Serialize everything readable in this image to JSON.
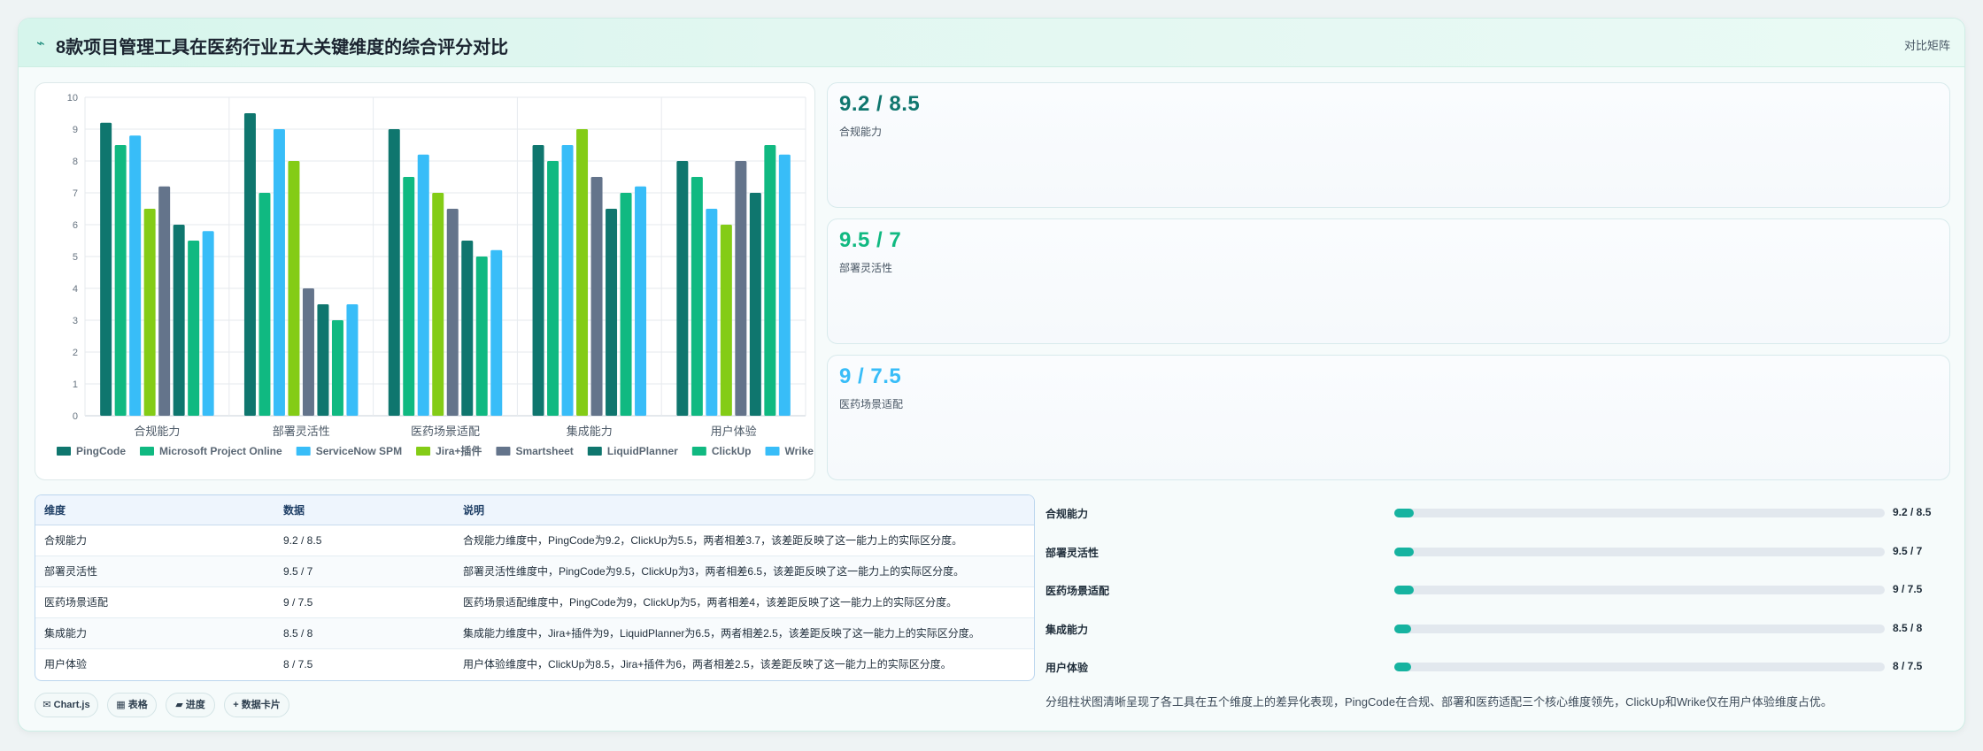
{
  "header": {
    "title": "8款项目管理工具在医药行业五大关键维度的综合评分对比",
    "badge": "对比矩阵",
    "icon": "chart-icon"
  },
  "chart_data": {
    "type": "bar",
    "categories": [
      "合规能力",
      "部署灵活性",
      "医药场景适配",
      "集成能力",
      "用户体验"
    ],
    "ylim": [
      0,
      10
    ],
    "yticks": [
      0,
      1,
      2,
      3,
      4,
      5,
      6,
      7,
      8,
      9,
      10
    ],
    "legend_position": "bottom",
    "grid": true,
    "series": [
      {
        "name": "PingCode",
        "color": "#0f766e",
        "values": [
          9.2,
          9.5,
          9,
          8.5,
          8
        ]
      },
      {
        "name": "Microsoft Project Online",
        "color": "#10b981",
        "values": [
          8.5,
          7,
          7.5,
          8,
          7.5
        ]
      },
      {
        "name": "ServiceNow SPM",
        "color": "#38bdf8",
        "values": [
          8.8,
          9,
          8.2,
          8.5,
          6.5
        ]
      },
      {
        "name": "Jira+插件",
        "color": "#84cc16",
        "values": [
          6.5,
          8,
          7,
          9,
          6
        ]
      },
      {
        "name": "Smartsheet",
        "color": "#64748b",
        "values": [
          7.2,
          4,
          6.5,
          7.5,
          8
        ]
      },
      {
        "name": "LiquidPlanner",
        "color": "#0f766e",
        "values": [
          6,
          3.5,
          5.5,
          6.5,
          7
        ]
      },
      {
        "name": "ClickUp",
        "color": "#10b981",
        "values": [
          5.5,
          3,
          5,
          7,
          8.5
        ]
      },
      {
        "name": "Wrike",
        "color": "#38bdf8",
        "values": [
          5.8,
          3.5,
          5.2,
          7.2,
          8.2
        ]
      }
    ]
  },
  "kpis": [
    {
      "value": "9.2 / 8.5",
      "label": "合规能力",
      "color": "#0f766e"
    },
    {
      "value": "9.5 / 7",
      "label": "部署灵活性",
      "color": "#10b981"
    },
    {
      "value": "9 / 7.5",
      "label": "医药场景适配",
      "color": "#38bdf8"
    }
  ],
  "table": {
    "headers": [
      "维度",
      "数据",
      "说明"
    ],
    "rows": [
      [
        "合规能力",
        "9.2 / 8.5",
        "合规能力维度中，PingCode为9.2，ClickUp为5.5，两者相差3.7，该差距反映了这一能力上的实际区分度。"
      ],
      [
        "部署灵活性",
        "9.5 / 7",
        "部署灵活性维度中，PingCode为9.5，ClickUp为3，两者相差6.5，该差距反映了这一能力上的实际区分度。"
      ],
      [
        "医药场景适配",
        "9 / 7.5",
        "医药场景适配维度中，PingCode为9，ClickUp为5，两者相差4，该差距反映了这一能力上的实际区分度。"
      ],
      [
        "集成能力",
        "8.5 / 8",
        "集成能力维度中，Jira+插件为9，LiquidPlanner为6.5，两者相差2.5，该差距反映了这一能力上的实际区分度。"
      ],
      [
        "用户体验",
        "8 / 7.5",
        "用户体验维度中，ClickUp为8.5，Jira+插件为6，两者相差2.5，该差距反映了这一能力上的实际区分度。"
      ]
    ]
  },
  "tags": [
    "✉ Chart.js",
    "▦ 表格",
    "▰ 进度",
    "+ 数据卡片"
  ],
  "progress": [
    {
      "label": "合规能力",
      "value": "9.2 / 8.5",
      "fraction": 0.04
    },
    {
      "label": "部署灵活性",
      "value": "9.5 / 7",
      "fraction": 0.04
    },
    {
      "label": "医药场景适配",
      "value": "9 / 7.5",
      "fraction": 0.04
    },
    {
      "label": "集成能力",
      "value": "8.5 / 8",
      "fraction": 0.035
    },
    {
      "label": "用户体验",
      "value": "8 / 7.5",
      "fraction": 0.035
    }
  ],
  "summary": "分组柱状图清晰呈现了各工具在五个维度上的差异化表现，PingCode在合规、部署和医药适配三个核心维度领先，ClickUp和Wrike仅在用户体验维度占优。"
}
